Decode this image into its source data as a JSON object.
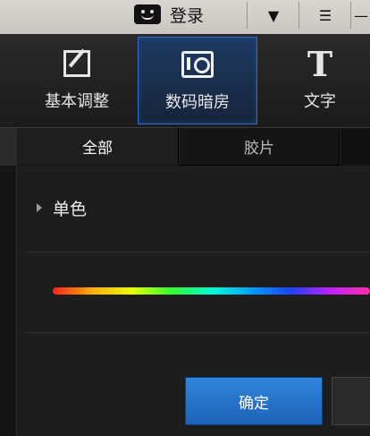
{
  "topbar": {
    "login_label": "登录",
    "buttons": [
      {
        "icon": "shirt-icon",
        "glyph": "👕"
      },
      {
        "icon": "menu-down-icon",
        "glyph": "⏷"
      },
      {
        "icon": "minimize-icon",
        "glyph": "—"
      }
    ]
  },
  "modes": [
    {
      "label": "基本调整",
      "icon": "edit-icon",
      "active": false
    },
    {
      "label": "数码暗房",
      "icon": "camera-icon",
      "active": true
    },
    {
      "label": "文字",
      "icon": "text-icon",
      "active": false
    }
  ],
  "subtabs": {
    "all": "全部",
    "film": "胶片"
  },
  "content": {
    "section_label": "单色",
    "confirm_label": "确定"
  },
  "colors": {
    "accent": "#2f86dc",
    "active_tab_border": "#2f6bc7"
  }
}
